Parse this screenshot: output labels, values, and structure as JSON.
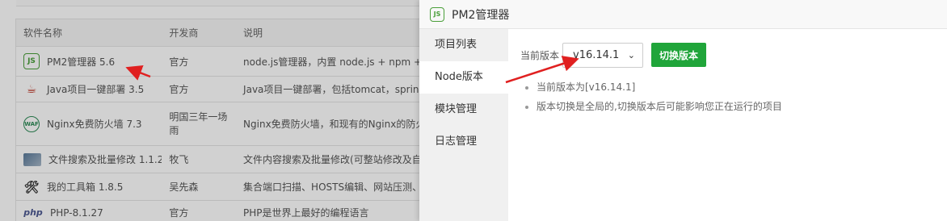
{
  "software_list": {
    "headers": [
      "软件名称",
      "开发商",
      "说明"
    ],
    "rows": [
      {
        "icon": "nodejs-icon",
        "name": "PM2管理器 5.6",
        "vendor": "官方",
        "desc": "node.js管理器，内置 node.js + npm + n"
      },
      {
        "icon": "java-icon",
        "name": "Java项目一键部署 3.5",
        "vendor": "官方",
        "desc": "Java项目一键部署，包括tomcat，spring"
      },
      {
        "icon": "waf-icon",
        "name": "Nginx免费防火墙 7.3",
        "vendor": "明国三年一场雨",
        "desc": "Nginx免费防火墙，和现有的Nginx的防火"
      },
      {
        "icon": "image-icon",
        "name": "文件搜索及批量修改 1.1.2",
        "vendor": "牧飞",
        "desc": "文件内容搜索及批量修改(可整站修改及自"
      },
      {
        "icon": "tools-icon",
        "name": "我的工具箱 1.8.5",
        "vendor": "吴先森",
        "desc": "集合端口扫描、HOSTS编辑、网站压测、"
      },
      {
        "icon": "php-icon",
        "name": "PHP-8.1.27",
        "vendor": "官方",
        "desc": "PHP是世界上最好的编程语言"
      }
    ]
  },
  "modal": {
    "title": "PM2管理器",
    "icon_label": "JS",
    "sidebar": [
      "项目列表",
      "Node版本",
      "模块管理",
      "日志管理"
    ],
    "active_tab": "Node版本",
    "current_version_label": "当前版本",
    "selected_version": "v16.14.1",
    "switch_button": "切换版本",
    "tips": [
      "当前版本为[v16.14.1]",
      "版本切换是全局的,切换版本后可能影响您正在运行的项目"
    ]
  },
  "colors": {
    "accent_green": "#20a53a",
    "arrow_red": "#e02020"
  }
}
